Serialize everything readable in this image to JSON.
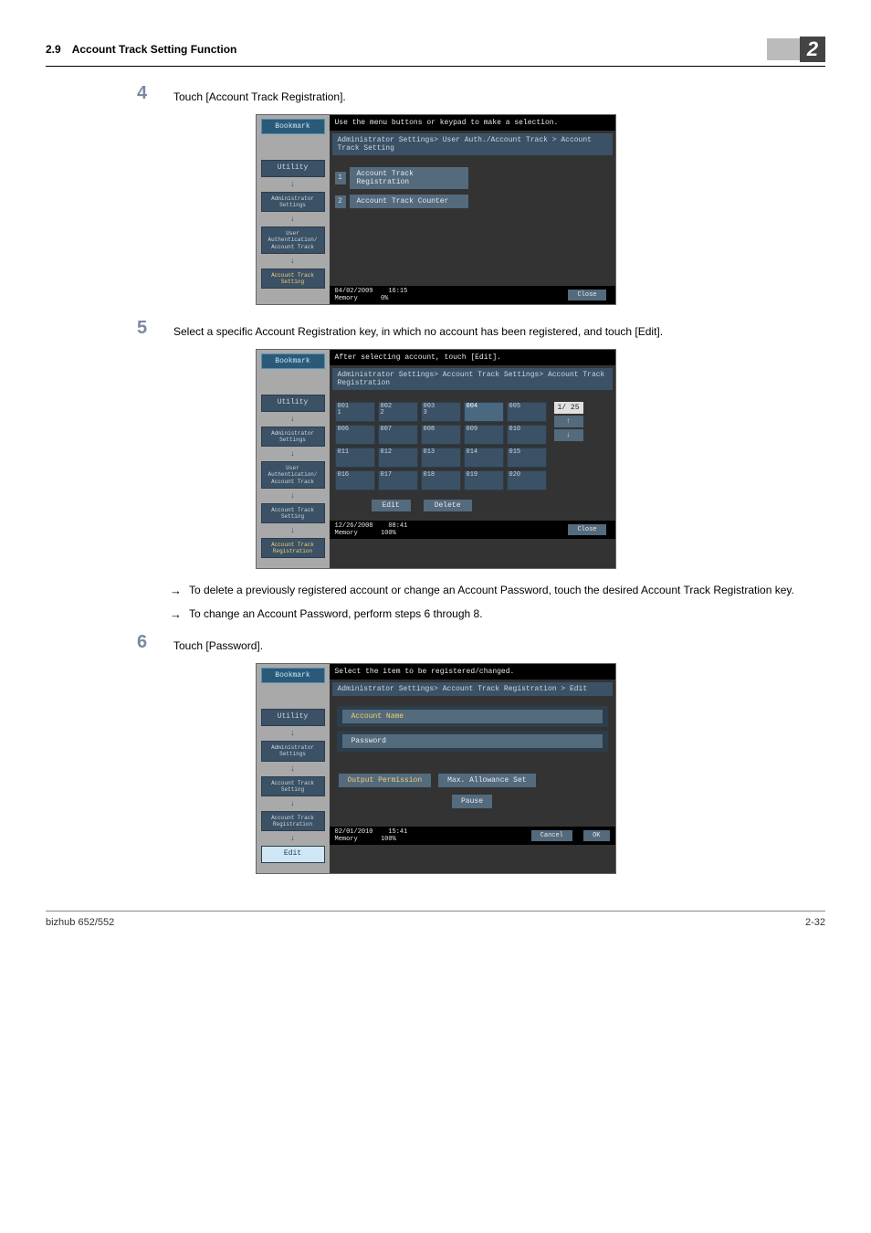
{
  "header": {
    "section_num": "2.9",
    "section_title": "Account Track Setting Function",
    "chapter": "2"
  },
  "steps": {
    "s4": {
      "num": "4",
      "text": "Touch [Account Track Registration]."
    },
    "s5": {
      "num": "5",
      "text": "Select a specific Account Registration key, in which no account has been registered, and touch [Edit]."
    },
    "s6": {
      "num": "6",
      "text": "Touch [Password]."
    }
  },
  "bullets": {
    "b1": "To delete a previously registered account or change an Account Password, touch the desired Account Track Registration key.",
    "b2": "To change an Account Password, perform steps 6 through 8."
  },
  "scr1": {
    "topmsg": "Use the menu buttons or keypad to make a selection.",
    "bookmark": "Bookmark",
    "crumb": "Administrator Settings> User Auth./Account Track > Account Track Setting",
    "nav": {
      "utility": "Utility",
      "admin": "Administrator Settings",
      "userauth": "User Authentication/ Account Track",
      "acct_setting": "Account Track Setting"
    },
    "menu": {
      "m1": "Account Track Registration",
      "m2": "Account Track Counter"
    },
    "footer": {
      "date": "04/02/2009",
      "time": "16:15",
      "mem": "Memory",
      "memval": "0%",
      "close": "Close"
    }
  },
  "scr2": {
    "topmsg": "After selecting account, touch [Edit].",
    "bookmark": "Bookmark",
    "crumb": "Administrator Settings> Account Track Settings> Account Track Registration",
    "nav": {
      "utility": "Utility",
      "admin": "Administrator Settings",
      "userauth": "User Authentication/ Account Track",
      "acct_setting": "Account Track Setting",
      "acct_reg": "Account Track Registration"
    },
    "cells": {
      "c001": "001",
      "c001s": "1",
      "c002": "002",
      "c002s": "2",
      "c003": "003",
      "c003s": "3",
      "c004": "004",
      "c005": "005",
      "c006": "006",
      "c007": "007",
      "c008": "008",
      "c009": "009",
      "c010": "010",
      "c011": "011",
      "c012": "012",
      "c013": "013",
      "c014": "014",
      "c015": "015",
      "c016": "016",
      "c017": "017",
      "c018": "018",
      "c019": "019",
      "c020": "020"
    },
    "pager": "1/ 25",
    "edit": "Edit",
    "delete": "Delete",
    "footer": {
      "date": "12/26/2008",
      "time": "08:41",
      "mem": "Memory",
      "memval": "100%",
      "close": "Close"
    }
  },
  "scr3": {
    "topmsg": "Select the item to be registered/changed.",
    "bookmark": "Bookmark",
    "crumb": "Administrator Settings> Account Track Registration > Edit",
    "nav": {
      "utility": "Utility",
      "admin": "Administrator Settings",
      "acct_setting": "Account Track Setting",
      "acct_reg": "Account Track Registration",
      "edit": "Edit"
    },
    "btns": {
      "acctname": "Account Name",
      "password": "Password",
      "outperm": "Output Permission",
      "maxallow": "Max. Allowance Set",
      "pause": "Pause"
    },
    "footer": {
      "date": "02/01/2010",
      "time": "15:41",
      "mem": "Memory",
      "memval": "100%",
      "cancel": "Cancel",
      "ok": "OK"
    }
  },
  "page_footer": {
    "model": "bizhub 652/552",
    "pagenum": "2-32"
  }
}
